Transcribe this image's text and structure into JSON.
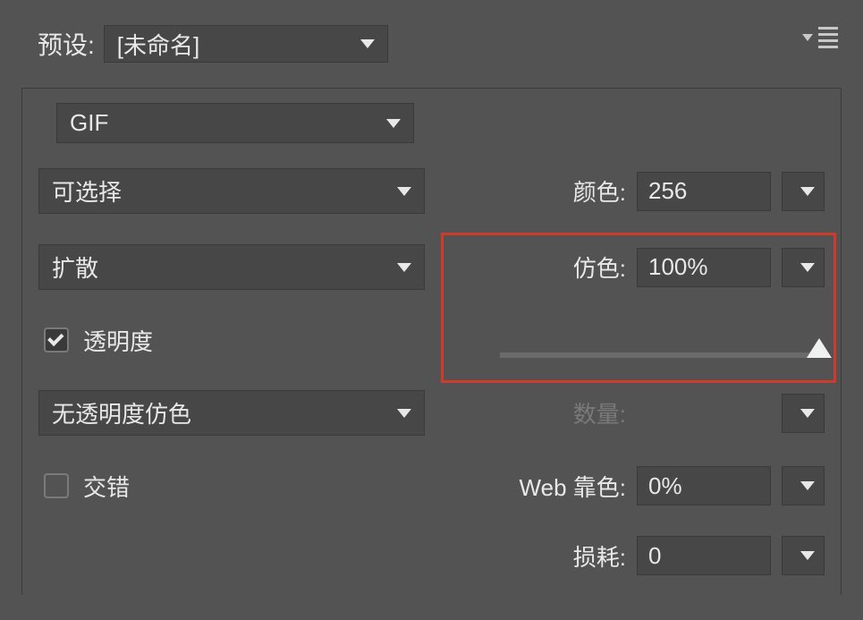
{
  "preset": {
    "label": "预设:",
    "value": "[未命名]"
  },
  "format": {
    "value": "GIF"
  },
  "reduction": {
    "value": "可选择"
  },
  "dither": {
    "value": "扩散"
  },
  "transparency": {
    "label": "透明度",
    "checked": true
  },
  "transparencyDither": {
    "value": "无透明度仿色"
  },
  "interlace": {
    "label": "交错",
    "checked": false
  },
  "colors": {
    "label": "颜色:",
    "value": "256"
  },
  "ditherAmount": {
    "label": "仿色:",
    "value": "100%"
  },
  "amount": {
    "label": "数量:",
    "value": ""
  },
  "webSnap": {
    "label": "Web 靠色:",
    "value": "0%"
  },
  "lossy": {
    "label": "损耗:",
    "value": "0"
  }
}
